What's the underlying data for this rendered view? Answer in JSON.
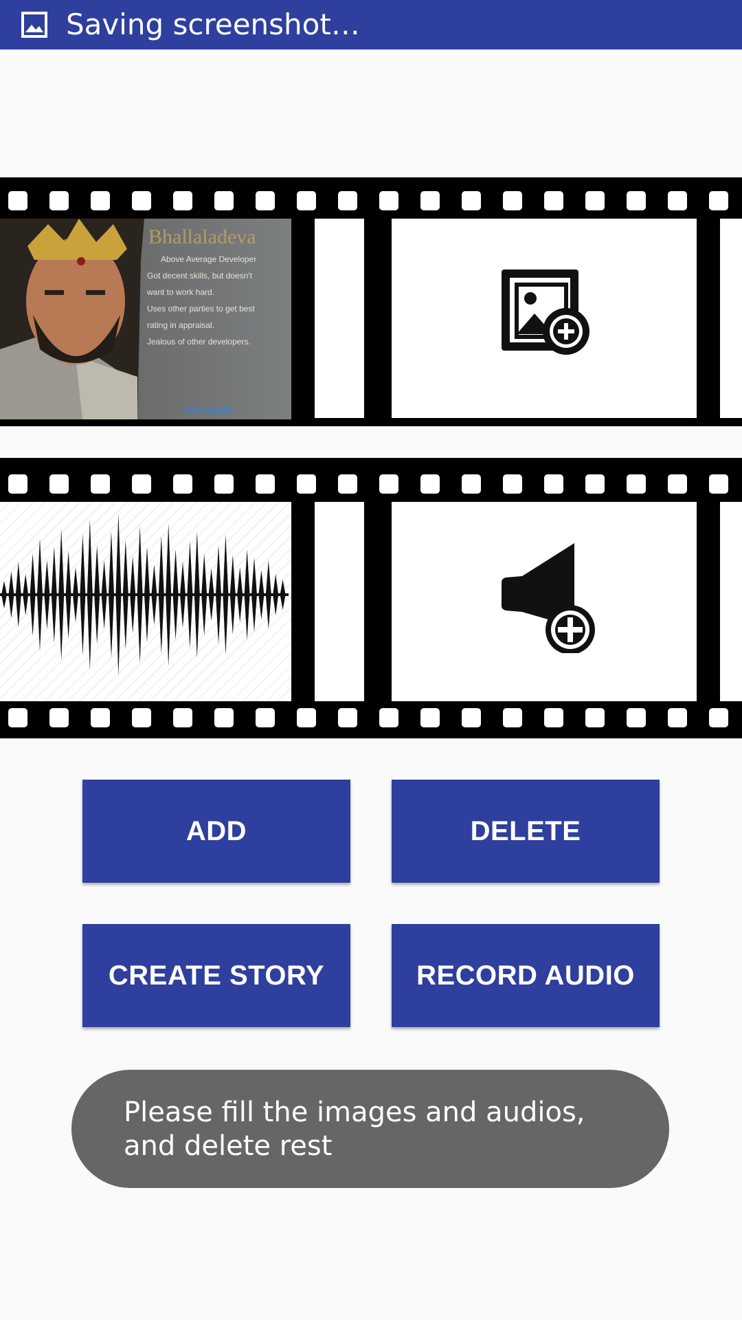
{
  "status_bar": {
    "text": "Saving screenshot…",
    "icon": "image-icon"
  },
  "film": {
    "image_slot": {
      "title": "Bhallaladeva",
      "lines": [
        "Above Average Developer",
        "Got decent skills, but doesn't",
        "want to work hard.",
        "Uses other parties to get best",
        "rating in appraisal.",
        "Jealous of other developers."
      ],
      "watermark": "www.geekit"
    },
    "add_image_icon": "add-image-icon",
    "add_audio_icon": "add-audio-icon"
  },
  "buttons": {
    "add": "ADD",
    "delete": "DELETE",
    "create_story": "CREATE STORY",
    "record_audio": "RECORD AUDIO"
  },
  "toast": {
    "message": "Please fill the images and audios, and delete rest"
  },
  "colors": {
    "primary": "#2f3f9e",
    "toast": "#666666"
  }
}
